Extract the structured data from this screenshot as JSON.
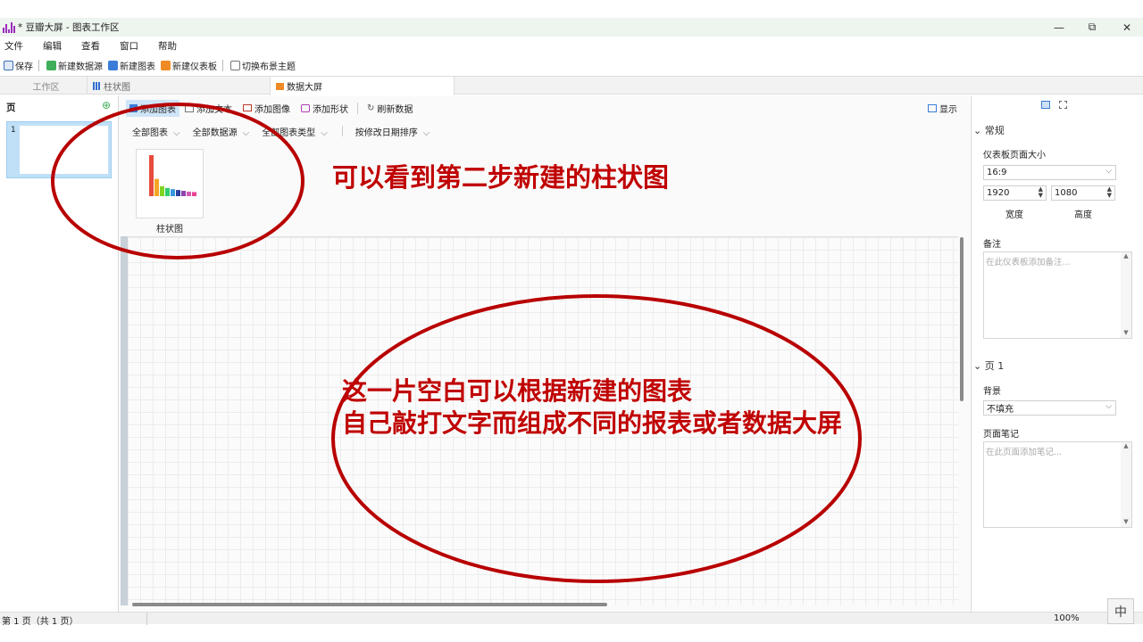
{
  "window": {
    "title": "* 豆瓣大屏 - 图表工作区",
    "minimize_glyph": "—",
    "restore_glyph": "⧉",
    "close_glyph": "✕"
  },
  "menu": [
    "文件",
    "编辑",
    "查看",
    "窗口",
    "帮助"
  ],
  "toolbar": {
    "save": "保存",
    "new_datasource": "新建数据源",
    "new_chart": "新建图表",
    "new_dashboard": "新建仪表板",
    "switch_theme": "切换布景主题"
  },
  "tabs": {
    "workspace": "工作区",
    "bar_chart": "柱状图",
    "big_screen": "数据大屏"
  },
  "left_panel": {
    "header": "页",
    "add_glyph": "⊕",
    "page_number": "1"
  },
  "canvas_toolbar": {
    "add_chart": "添加图表",
    "add_text": "添加文本",
    "add_image": "添加图像",
    "add_shape": "添加形状",
    "refresh": "刷新数据",
    "display": "显示"
  },
  "filters": {
    "all_charts": "全部图表",
    "all_datasources": "全部数据源",
    "all_chart_types": "全部图表类型",
    "sort": "按修改日期排序"
  },
  "gallery": {
    "items": [
      {
        "label": "柱状图",
        "bars": [
          10,
          4.2,
          2.4,
          2.0,
          1.7,
          1.5,
          1.3,
          1.1,
          1.0
        ],
        "colors": [
          "#e74c3c",
          "#f5a623",
          "#7ed321",
          "#2ecc71",
          "#3498db",
          "#2c3e9e",
          "#8e44ad",
          "#d35cb0",
          "#e84393"
        ]
      }
    ]
  },
  "right_panel": {
    "section_general": "常规",
    "page_size_label": "仪表板页面大小",
    "page_size_value": "16:9",
    "width_value": "1920",
    "height_value": "1080",
    "width_label": "宽度",
    "height_label": "高度",
    "notes_label": "备注",
    "notes_placeholder": "在此仪表板添加备注...",
    "section_page": "页 1",
    "background_label": "背景",
    "background_value": "不填充",
    "page_notes_label": "页面笔记",
    "page_notes_placeholder": "在此页面添加笔记..."
  },
  "status": {
    "page_info": "第 1 页（共 1 页）",
    "zoom": "100%",
    "ime": "中"
  },
  "annotations": {
    "top": "可以看到第二步新建的柱状图",
    "middle_line1": "这一片空白可以根据新建的图表",
    "middle_line2": "自己敲打文字而组成不同的报表或者数据大屏"
  }
}
